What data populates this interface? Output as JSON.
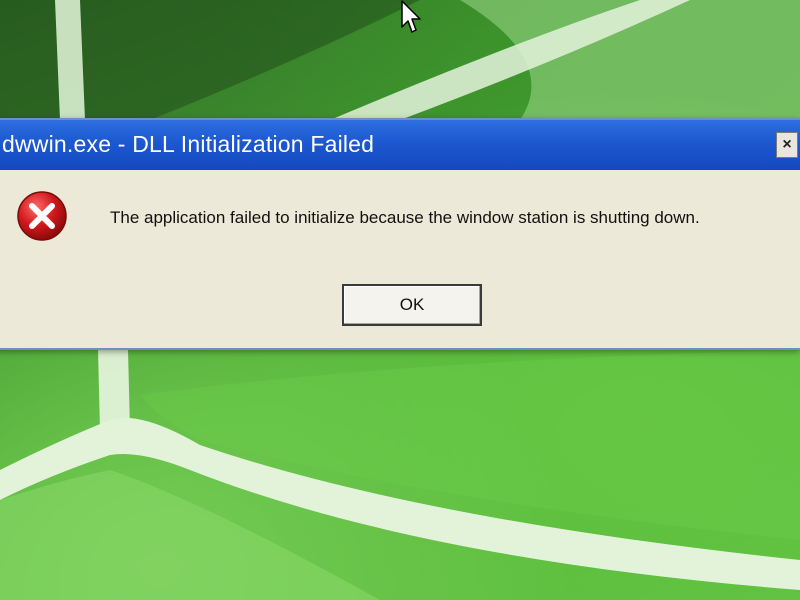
{
  "dialog": {
    "title": "dwwin.exe - DLL Initialization Failed",
    "message": "The application failed to initialize because the window station is shutting down.",
    "ok_label": "OK",
    "close_label": "×",
    "icon": "error-icon"
  },
  "desktop": {
    "wallpaper": "green-leaf",
    "cursor_icon": "arrow-cursor-icon"
  },
  "colors": {
    "titlebar": "#1c58d0",
    "dialog_bg": "#ece9d8",
    "error_red": "#c8102e",
    "leaf_green": "#55b63a"
  }
}
